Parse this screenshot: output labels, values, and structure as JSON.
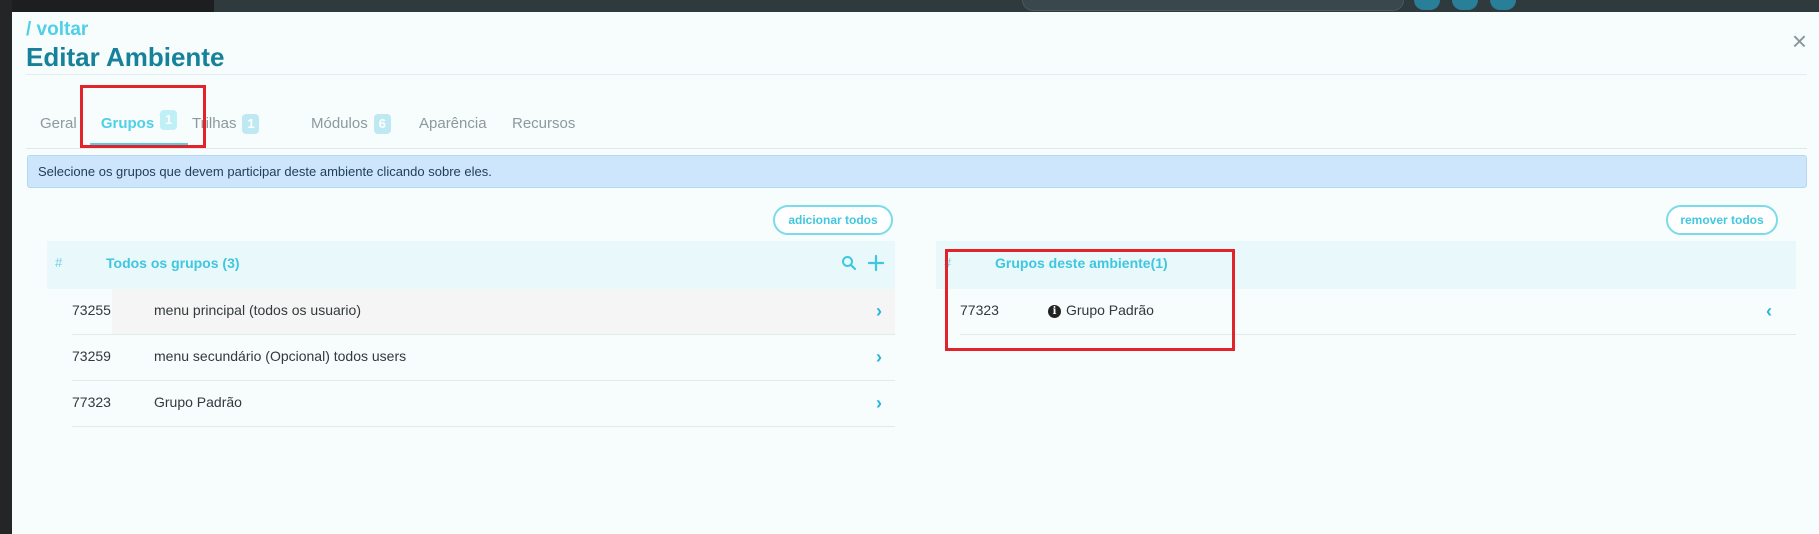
{
  "header": {
    "back_label": "/ voltar",
    "title": "Editar Ambiente",
    "close_glyph": "×"
  },
  "tabs": [
    {
      "label": "Geral",
      "badge": null
    },
    {
      "label": "Grupos",
      "badge": "1",
      "active": true
    },
    {
      "label": "Trilhas",
      "badge": "1"
    },
    {
      "label": "Módulos",
      "badge": "6"
    },
    {
      "label": "Aparência",
      "badge": null
    },
    {
      "label": "Recursos",
      "badge": null
    }
  ],
  "info_message": "Selecione os grupos que devem participar deste ambiente clicando sobre eles.",
  "left_panel": {
    "add_all_label": "adicionar todos",
    "hash_label": "#",
    "title": "Todos os grupos (3)",
    "search_icon": "search-icon",
    "plus_icon": "plus-icon",
    "rows": [
      {
        "id": "73255",
        "name": "menu principal (todos os usuario)",
        "chevron": "›"
      },
      {
        "id": "73259",
        "name": "menu secundário (Opcional) todos users",
        "chevron": "›"
      },
      {
        "id": "77323",
        "name": "Grupo Padrão",
        "chevron": "›"
      }
    ]
  },
  "right_panel": {
    "remove_all_label": "remover todos",
    "hash_label": "#",
    "title": "Grupos deste ambiente(1)",
    "rows": [
      {
        "id": "77323",
        "name": "Grupo Padrão",
        "info_glyph": "i",
        "chevron": "‹"
      }
    ]
  },
  "colors": {
    "accent": "#4fd0e6",
    "title": "#16829a",
    "highlight": "#e2232a",
    "banner_bg": "#cde6fb"
  }
}
